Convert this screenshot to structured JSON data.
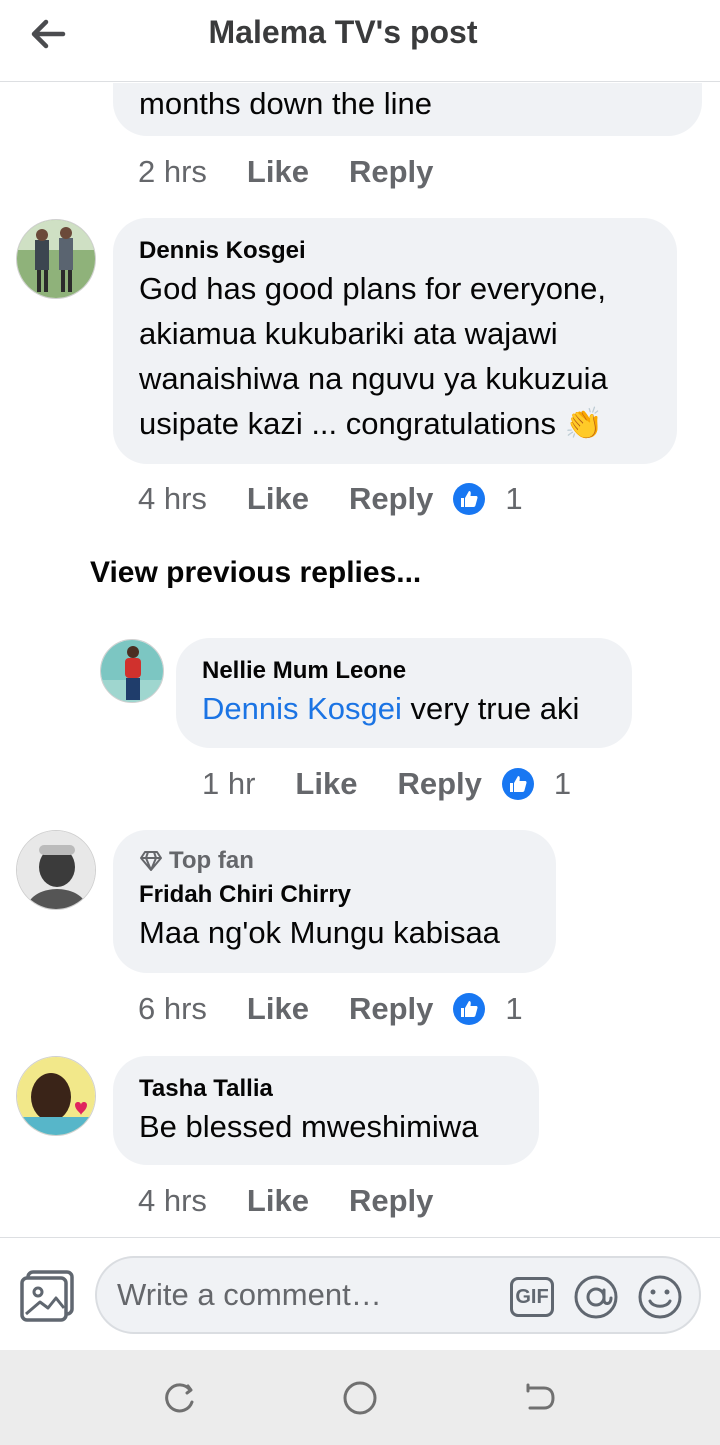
{
  "header": {
    "title": "Malema TV's post"
  },
  "comments": [
    {
      "text": "months down the line",
      "time": "2 hrs",
      "like_label": "Like",
      "reply_label": "Reply"
    },
    {
      "name": "Dennis Kosgei",
      "text_lines": [
        "God has good plans for everyone,",
        "akiamua kukubariki ata wajawi",
        "wanaishiwa na nguvu ya kukuzuia",
        "usipate kazi ... congratulations"
      ],
      "emoji": "👏",
      "time": "4 hrs",
      "like_label": "Like",
      "reply_label": "Reply",
      "reaction_count": "1"
    },
    {
      "name": "Nellie Mum Leone",
      "mention": "Dennis Kosgei",
      "text": " very true aki",
      "time": "1 hr",
      "like_label": "Like",
      "reply_label": "Reply",
      "reaction_count": "1"
    },
    {
      "badge": "Top fan",
      "name": "Fridah Chiri Chirry",
      "text": "Maa ng'ok Mungu kabisaa",
      "time": "6 hrs",
      "like_label": "Like",
      "reply_label": "Reply",
      "reaction_count": "1"
    },
    {
      "name": "Tasha Tallia",
      "text": "Be blessed mweshimiwa",
      "time": "4 hrs",
      "like_label": "Like",
      "reply_label": "Reply"
    }
  ],
  "view_previous_replies": "View previous replies...",
  "composer": {
    "placeholder": "Write a comment…",
    "gif_label": "GIF"
  },
  "colors": {
    "bubble": "#f0f2f5",
    "mention": "#1b74e4",
    "like_blue": "#1877f2",
    "secondary_text": "#65676b"
  }
}
